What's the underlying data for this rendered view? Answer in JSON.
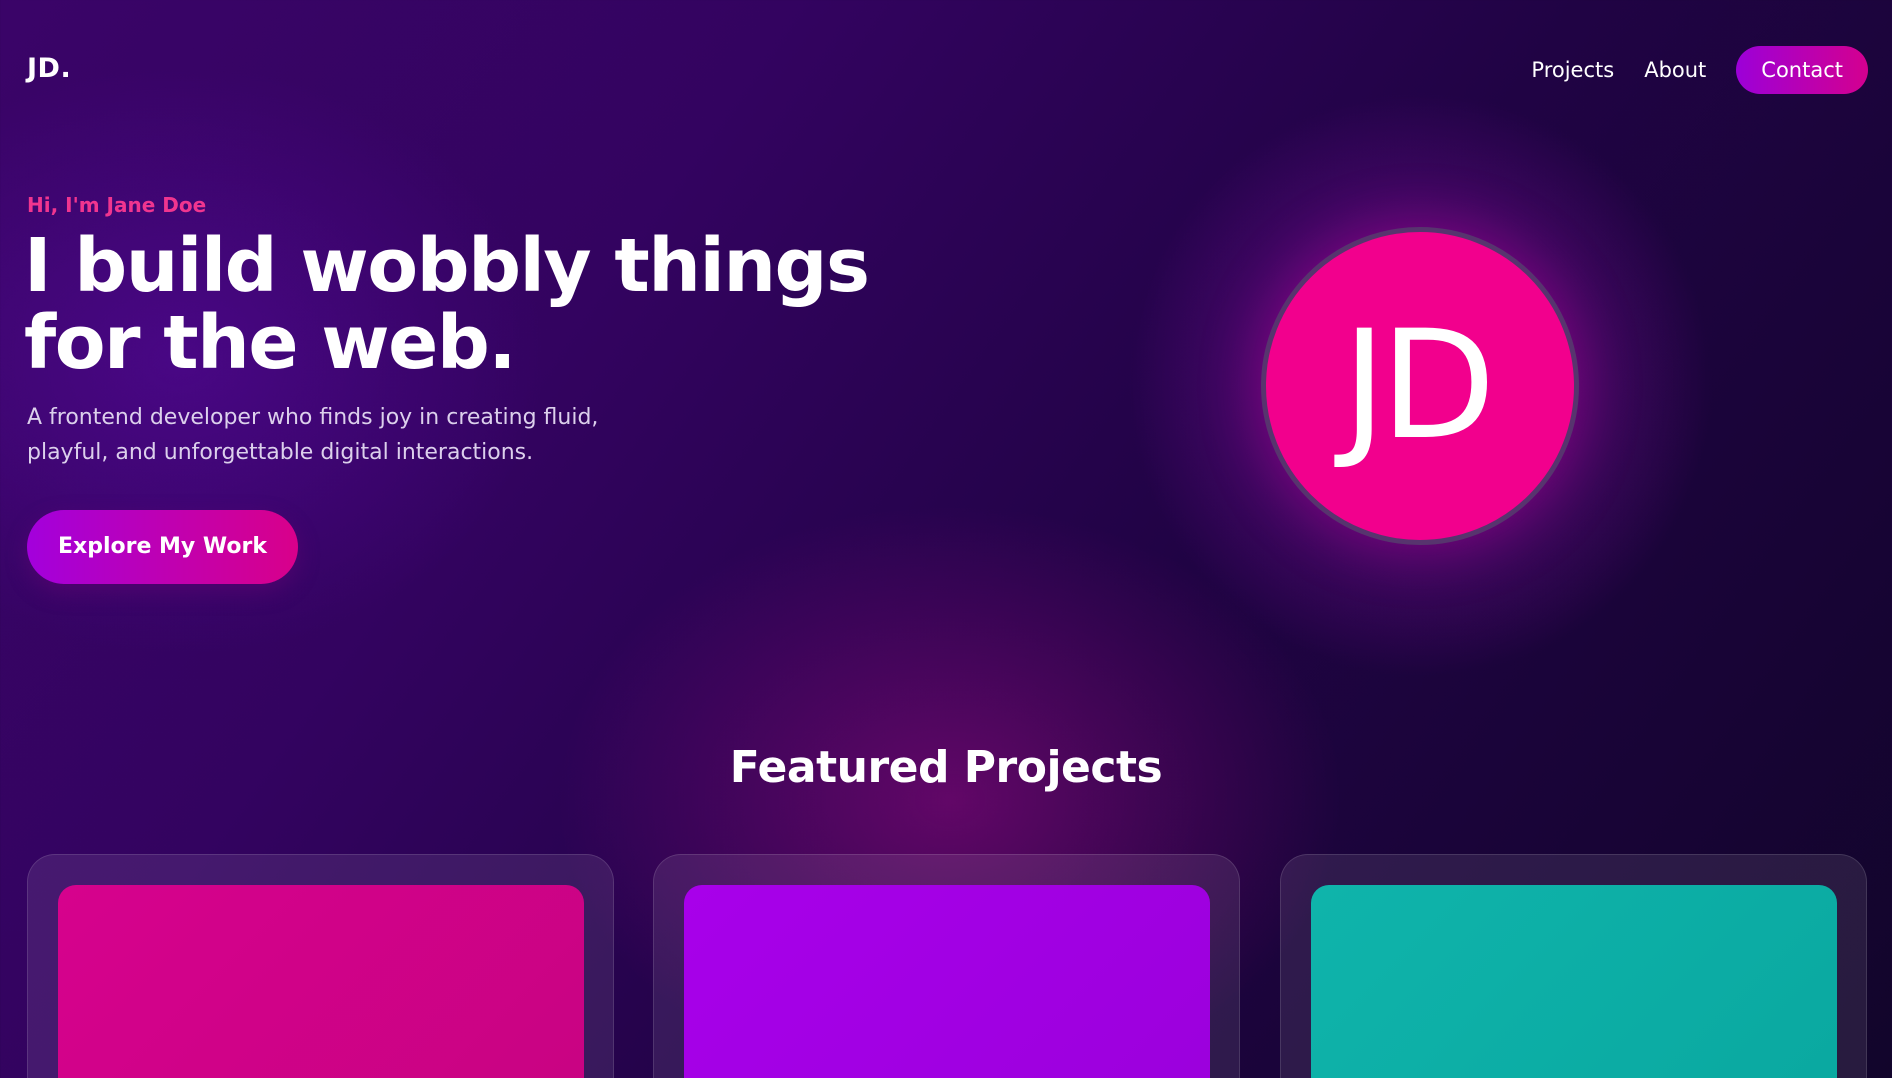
{
  "header": {
    "logo": "JD.",
    "nav": {
      "projects": "Projects",
      "about": "About",
      "contact": "Contact"
    }
  },
  "hero": {
    "eyebrow": "Hi, I'm Jane Doe",
    "title_lines": [
      "I build wobbly things",
      "for the web."
    ],
    "subtitle_lines": [
      "A frontend developer who finds joy in creating fluid,",
      "playful, and unforgettable digital interactions."
    ],
    "cta_label": "Explore My Work",
    "avatar_initials": "JD"
  },
  "projects": {
    "title": "Featured Projects",
    "cards": [
      {
        "thumb_color": "#d4028b"
      },
      {
        "thumb_color": "#a300e5"
      },
      {
        "thumb_color": "#0db1a7"
      }
    ]
  },
  "colors": {
    "accent_pink": "#f2008d",
    "accent_purple": "#a300dc",
    "eyebrow_pink": "#f0358f",
    "background_dark": "#1a0438"
  }
}
